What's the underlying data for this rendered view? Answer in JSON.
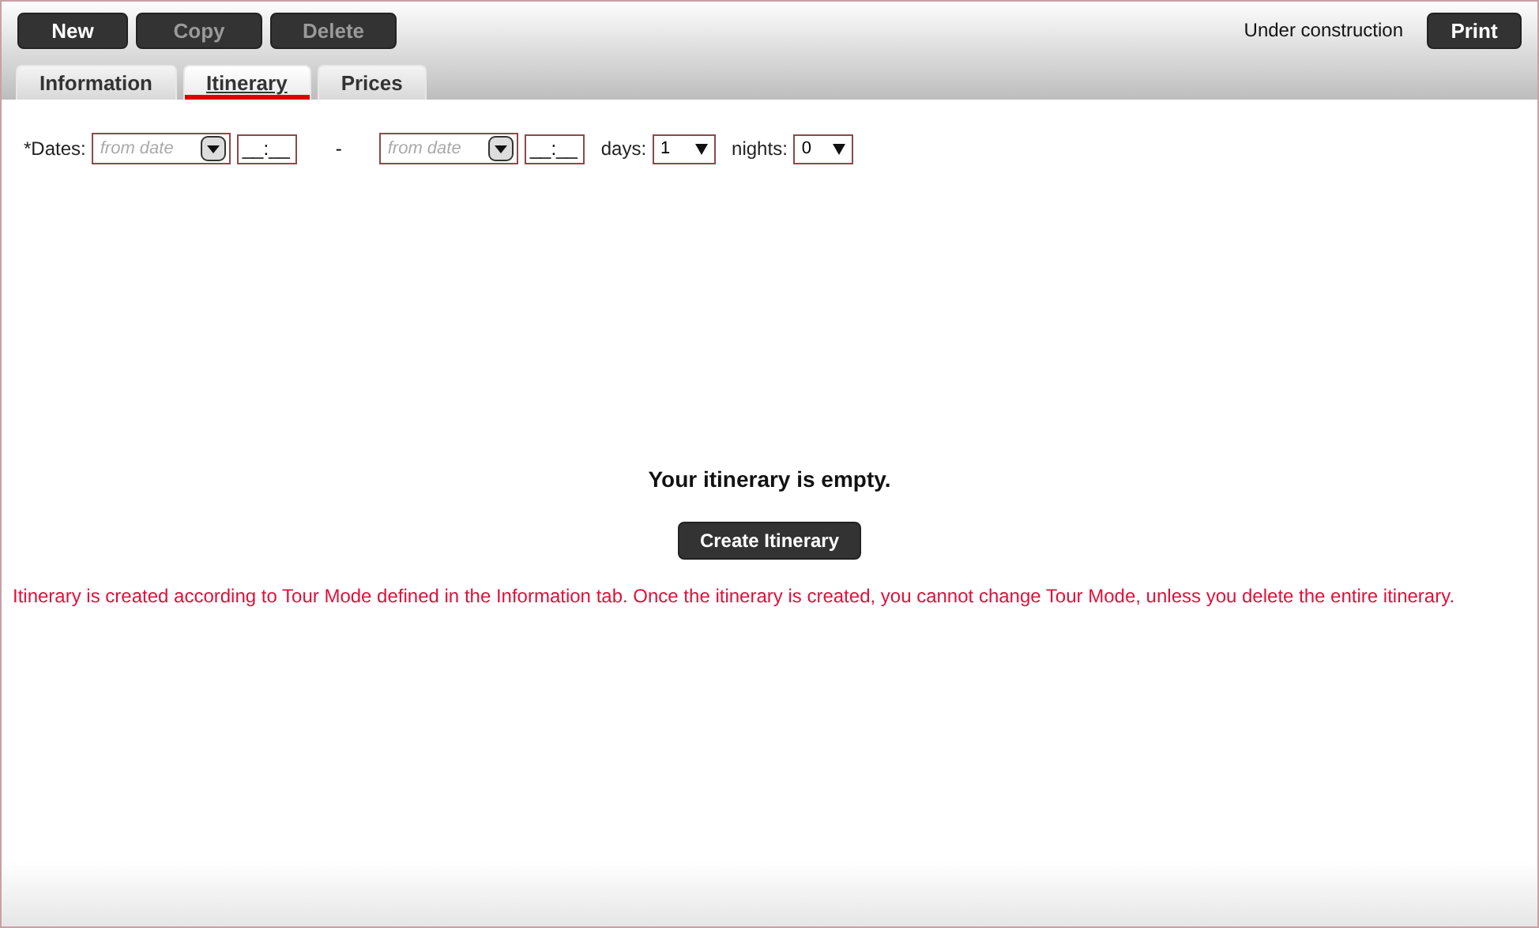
{
  "toolbar": {
    "buttons": [
      {
        "label": "New",
        "disabled": false
      },
      {
        "label": "Copy",
        "disabled": true
      },
      {
        "label": "Delete",
        "disabled": true
      }
    ],
    "status": "Under construction",
    "print": "Print"
  },
  "tabs": [
    {
      "label": "Information",
      "selected": false
    },
    {
      "label": "Itinerary",
      "selected": true
    },
    {
      "label": "Prices",
      "selected": false
    }
  ],
  "dates": {
    "label": "*Dates:",
    "from": {
      "placeholder": "from date",
      "time": "__:__"
    },
    "separator": "-",
    "to": {
      "placeholder": "from date",
      "time": "__:__"
    },
    "days_label": "days:",
    "days": "1",
    "nights_label": "nights:",
    "nights": "0"
  },
  "empty_message": "Your itinerary is empty.",
  "create_button": "Create Itinerary",
  "notice": "Itinerary is created according to Tour Mode defined in the Information tab. Once the itinerary is created, you cannot change Tour Mode, unless you delete the entire itinerary."
}
